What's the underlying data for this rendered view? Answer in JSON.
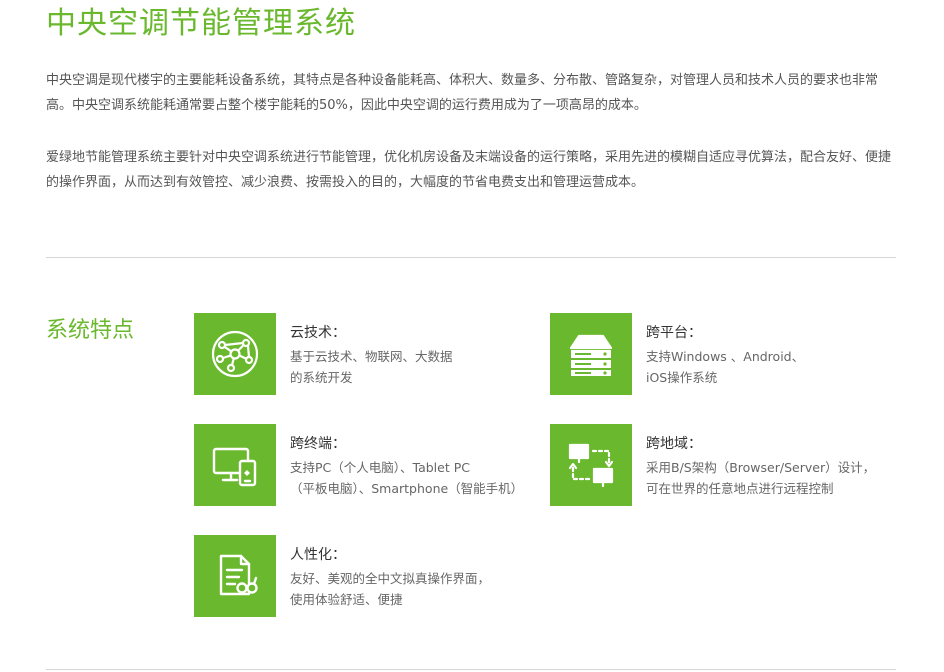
{
  "header": {
    "title": "中央空调节能管理系统"
  },
  "intro": {
    "paragraph1": "中央空调是现代楼宇的主要能耗设备系统，其特点是各种设备能耗高、体积大、数量多、分布散、管路复杂，对管理人员和技术人员的要求也非常高。中央空调系统能耗通常要占整个楼宇能耗的50%，因此中央空调的运行费用成为了一项高昂的成本。",
    "paragraph2": "爱绿地节能管理系统主要针对中央空调系统进行节能管理，优化机房设备及末端设备的运行策略，采用先进的模糊自适应寻优算法，配合友好、便捷的操作界面，从而达到有效管控、减少浪费、按需投入的目的，大幅度的节省电费支出和管理运营成本。"
  },
  "features_section": {
    "title": "系统特点",
    "accent_color": "#6ab82e",
    "items": [
      {
        "icon": "cloud-network-icon",
        "title": "云技术：",
        "desc_lines": [
          "基于云技术、物联网、大数据",
          "的系统开发"
        ]
      },
      {
        "icon": "server-rack-icon",
        "title": "跨平台：",
        "desc_lines": [
          "支持Windows 、Android、",
          "iOS操作系统"
        ]
      },
      {
        "icon": "multi-device-icon",
        "title": "跨终端：",
        "desc_lines": [
          "支持PC（个人电脑）、Tablet PC",
          "（平板电脑）、Smartphone（智能手机）"
        ]
      },
      {
        "icon": "remote-network-icon",
        "title": "跨地域：",
        "desc_lines": [
          "采用B/S架构（Browser/Server）设计，",
          "可在世界的任意地点进行远程控制"
        ]
      },
      {
        "icon": "document-edit-icon",
        "title": "人性化：",
        "desc_lines": [
          "友好、美观的全中文拟真操作界面，",
          "使用体验舒适、便捷"
        ]
      }
    ]
  }
}
